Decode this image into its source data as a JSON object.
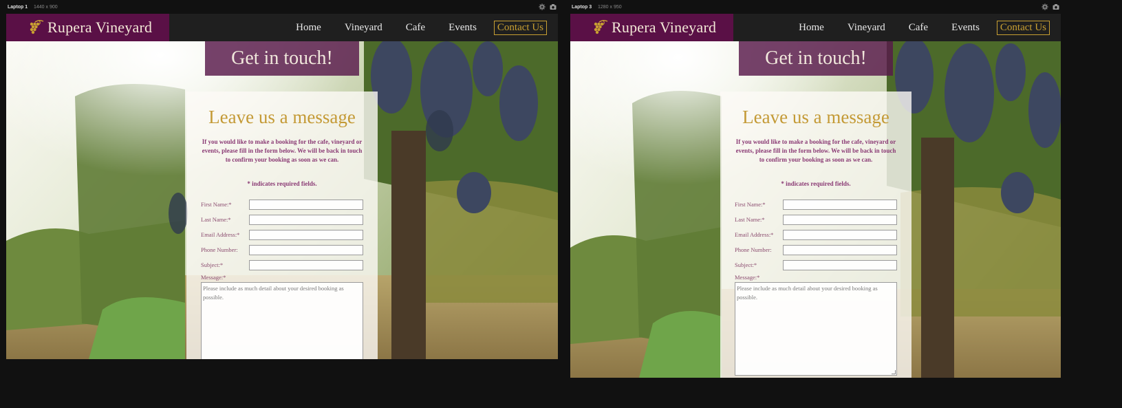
{
  "devices": [
    {
      "name": "Laptop 1",
      "size": "1440 x 900",
      "site": {
        "brand": "Rupera Vineyard",
        "nav": [
          "Home",
          "Vineyard",
          "Cafe",
          "Events"
        ],
        "contact": "Contact Us",
        "banner": "Get in touch!",
        "form_title": "Leave us a message",
        "form_intro": "If you would like to make a booking for the cafe, vineyard or events, please fill in the form below. We will be back in touch to confirm your booking as soon as we can.",
        "required_note": "* indicates required fields.",
        "fields": [
          "First Name:*",
          "Last Name:*",
          "Email Address:*",
          "Phone Number:",
          "Subject:*"
        ],
        "message_label": "Message:*",
        "message_placeholder": "Please include as much detail about your desired booking as possible."
      }
    },
    {
      "name": "Laptop 3",
      "size": "1280 x 950",
      "site": {
        "brand": "Rupera Vineyard",
        "nav": [
          "Home",
          "Vineyard",
          "Cafe",
          "Events"
        ],
        "contact": "Contact Us",
        "banner": "Get in touch!",
        "form_title": "Leave us a message",
        "form_intro": "If you would like to make a booking for the cafe, vineyard or events, please fill in the form below. We will be back in touch to confirm your booking as soon as we can.",
        "required_note": "* indicates required fields.",
        "fields": [
          "First Name:*",
          "Last Name:*",
          "Email Address:*",
          "Phone Number:",
          "Subject:*"
        ],
        "message_label": "Message:*",
        "message_placeholder": "Please include as much detail about your desired booking as possible."
      }
    }
  ],
  "icons": {
    "settings": "gear-icon",
    "screenshot": "camera-icon",
    "logo": "grape-vine-logo-icon"
  },
  "colors": {
    "brand_purple": "#5a1046",
    "accent_gold": "#c9a032",
    "nav_dark": "#1f1f1f",
    "form_text": "#8a3a74"
  }
}
